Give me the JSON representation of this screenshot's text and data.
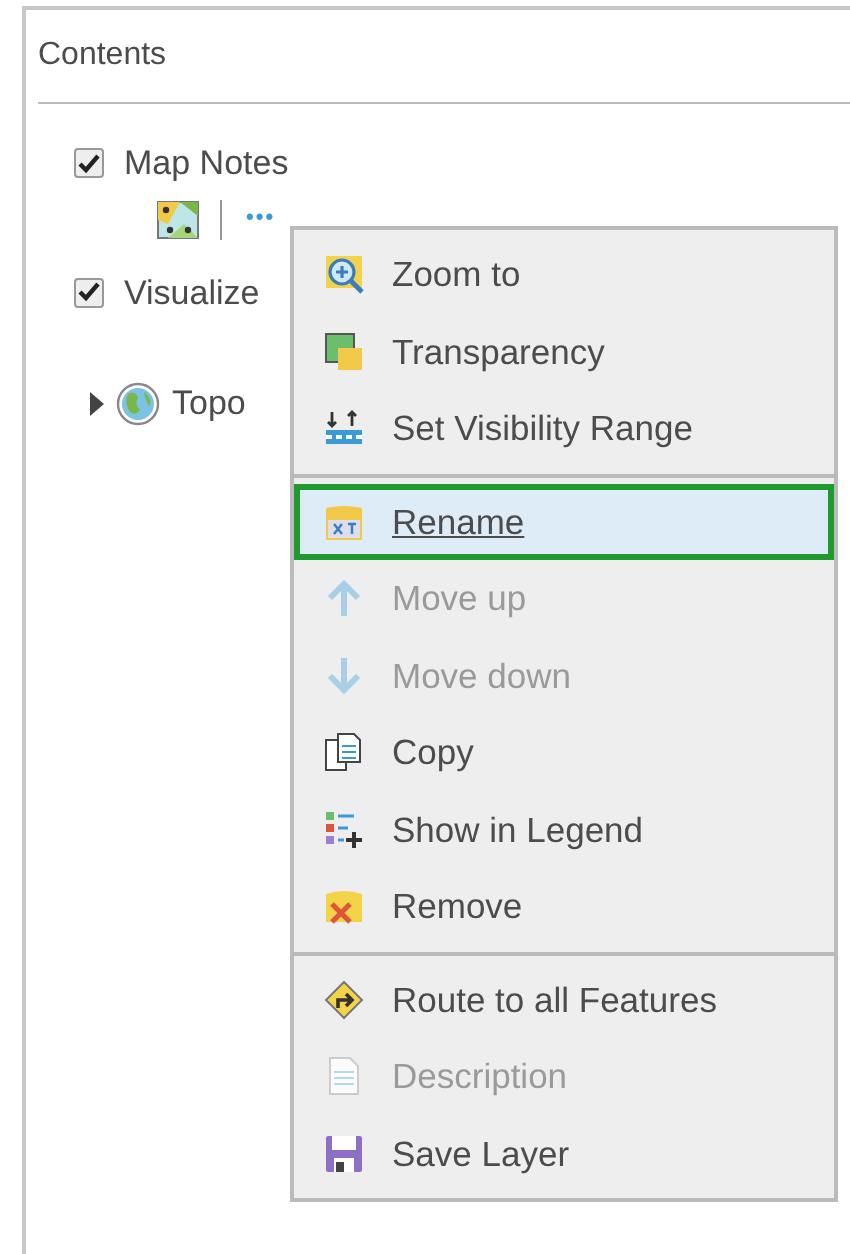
{
  "panel": {
    "title": "Contents"
  },
  "layers": [
    {
      "name": "Map Notes",
      "kind": "checkbox",
      "checked": true,
      "tools": {
        "more": "•••"
      }
    },
    {
      "name": "Visualize",
      "kind": "checkbox",
      "checked": true
    },
    {
      "name": "Topo",
      "kind": "basemap",
      "expanded": false
    }
  ],
  "menu": {
    "groups": [
      [
        {
          "label": "Zoom to",
          "disabled": false,
          "selected": false
        },
        {
          "label": "Transparency",
          "disabled": false,
          "selected": false
        },
        {
          "label": "Set Visibility Range",
          "disabled": false,
          "selected": false
        }
      ],
      [
        {
          "label": "Rename",
          "disabled": false,
          "selected": true
        },
        {
          "label": "Move up",
          "disabled": true,
          "selected": false
        },
        {
          "label": "Move down",
          "disabled": true,
          "selected": false
        },
        {
          "label": "Copy",
          "disabled": false,
          "selected": false
        },
        {
          "label": "Show in Legend",
          "disabled": false,
          "selected": false
        },
        {
          "label": "Remove",
          "disabled": false,
          "selected": false
        }
      ],
      [
        {
          "label": "Route to all Features",
          "disabled": false,
          "selected": false
        },
        {
          "label": "Description",
          "disabled": true,
          "selected": false
        },
        {
          "label": "Save Layer",
          "disabled": false,
          "selected": false
        }
      ]
    ]
  }
}
